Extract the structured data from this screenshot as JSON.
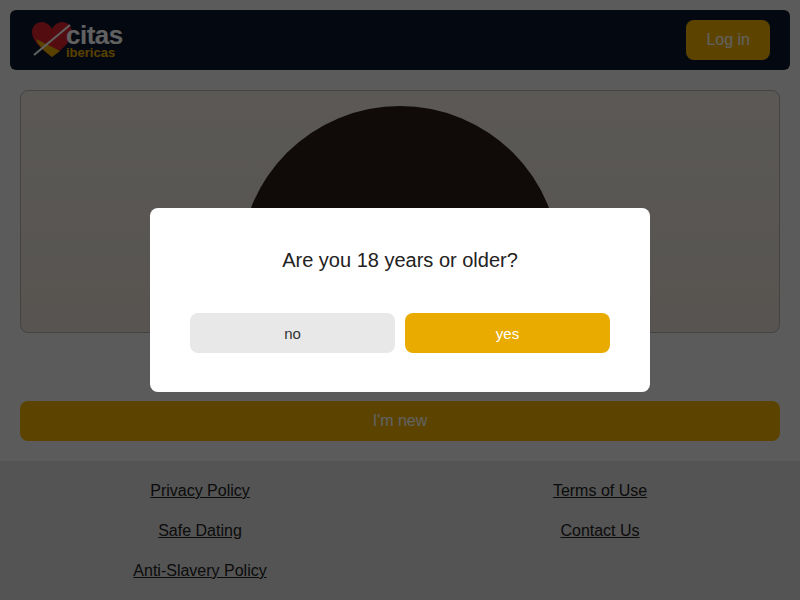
{
  "header": {
    "logo": {
      "name": "citas",
      "tagline": "ibericas"
    },
    "login_button": "Log in"
  },
  "new_button": "I'm new",
  "footer_links": [
    "Privacy Policy",
    "Terms of Use",
    "Safe Dating",
    "Contact Us",
    "Anti-Slavery Policy"
  ],
  "modal": {
    "question": "Are you 18 years or older?",
    "buttons": [
      {
        "label": "no",
        "kind": "secondary"
      },
      {
        "label": "yes",
        "kind": "primary"
      }
    ]
  }
}
